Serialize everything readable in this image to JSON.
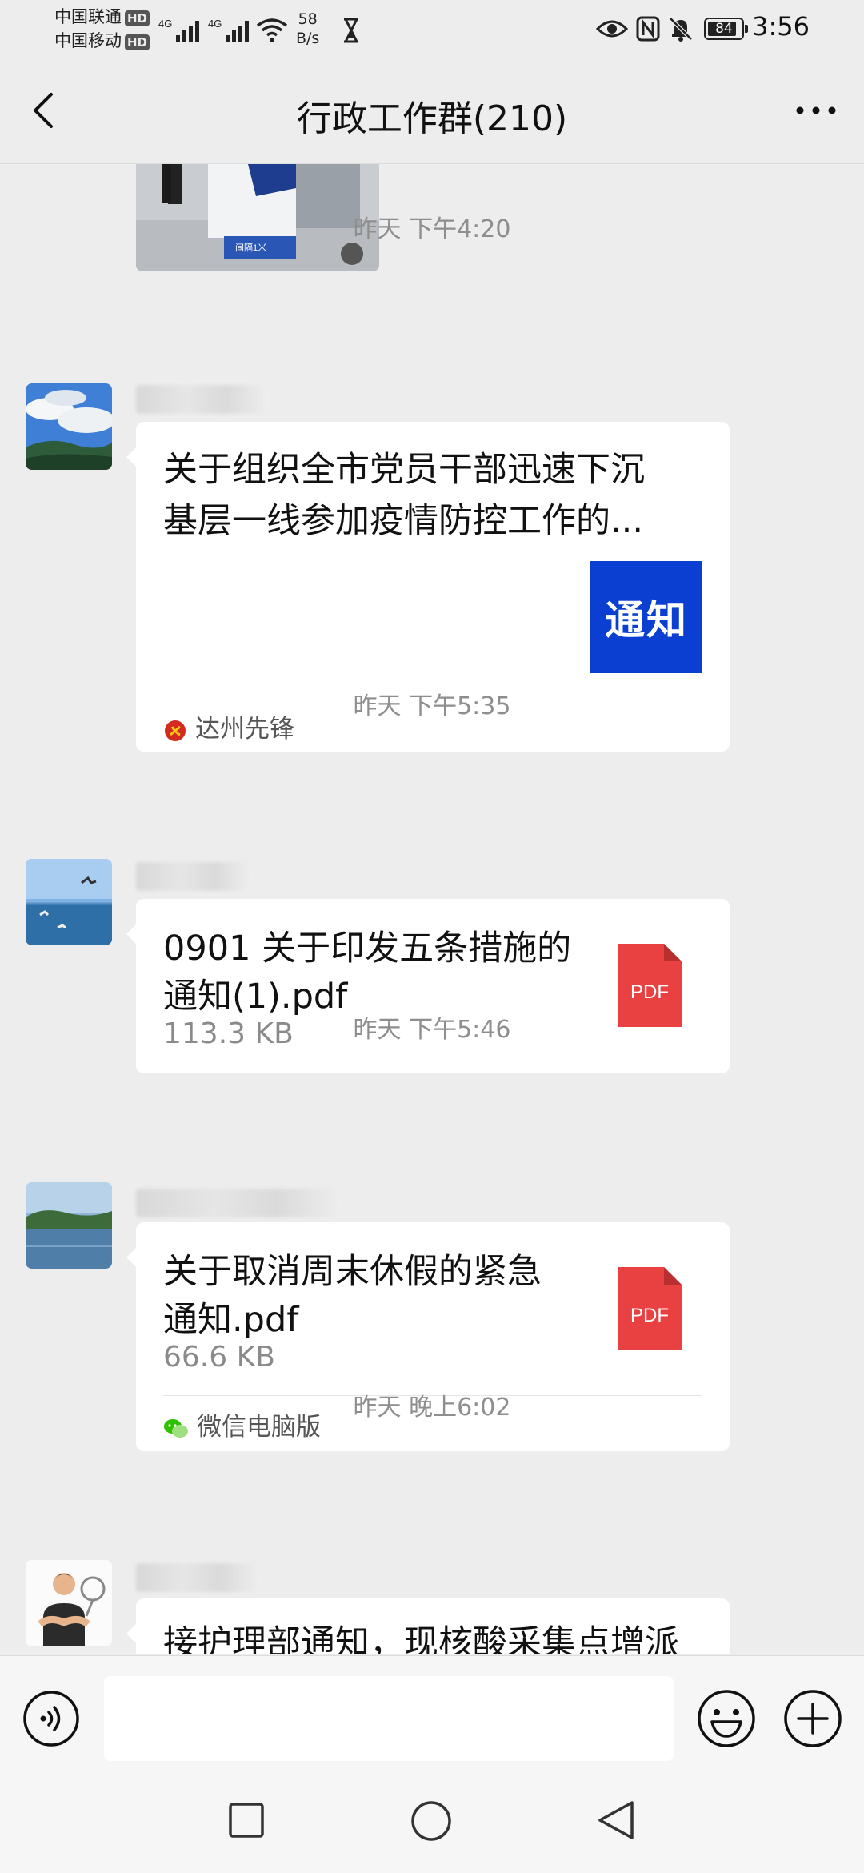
{
  "status_bar": {
    "carrier_1": "中国联通",
    "carrier_2": "中国移动",
    "hd_label": "HD",
    "net_speed_value": "58",
    "net_speed_unit": "B/s",
    "battery": "84",
    "time": "3:56"
  },
  "header": {
    "title": "行政工作群(210)"
  },
  "messages": [
    {
      "timestamp": "昨天 下午4:20",
      "text_line_1": "关于组织全市党员干部迅速下沉",
      "text_line_2": "基层一线参加疫情防控工作的...",
      "thumbnail_text": "通知",
      "source": "达州先锋"
    },
    {
      "timestamp": "昨天 下午5:35",
      "text_line_1": "0901 关于印发五条措施的",
      "text_line_2": "通知(1).pdf",
      "file_size": "113.3 KB",
      "file_icon_label": "PDF"
    },
    {
      "timestamp": "昨天 下午5:46",
      "text_line_1": "关于取消周末休假的紧急",
      "text_line_2": "通知.pdf",
      "file_size": "66.6 KB",
      "file_icon_label": "PDF",
      "source": "微信电脑版"
    },
    {
      "timestamp": "昨天 晚上6:02",
      "text_line_1": "接护理部通知，现核酸采集点增派"
    }
  ],
  "input_bar": {
    "placeholder": ""
  },
  "colors": {
    "background": "#ededed",
    "bubble": "#ffffff",
    "pdf_red": "#e94141",
    "notice_blue": "#0b3fd1"
  }
}
